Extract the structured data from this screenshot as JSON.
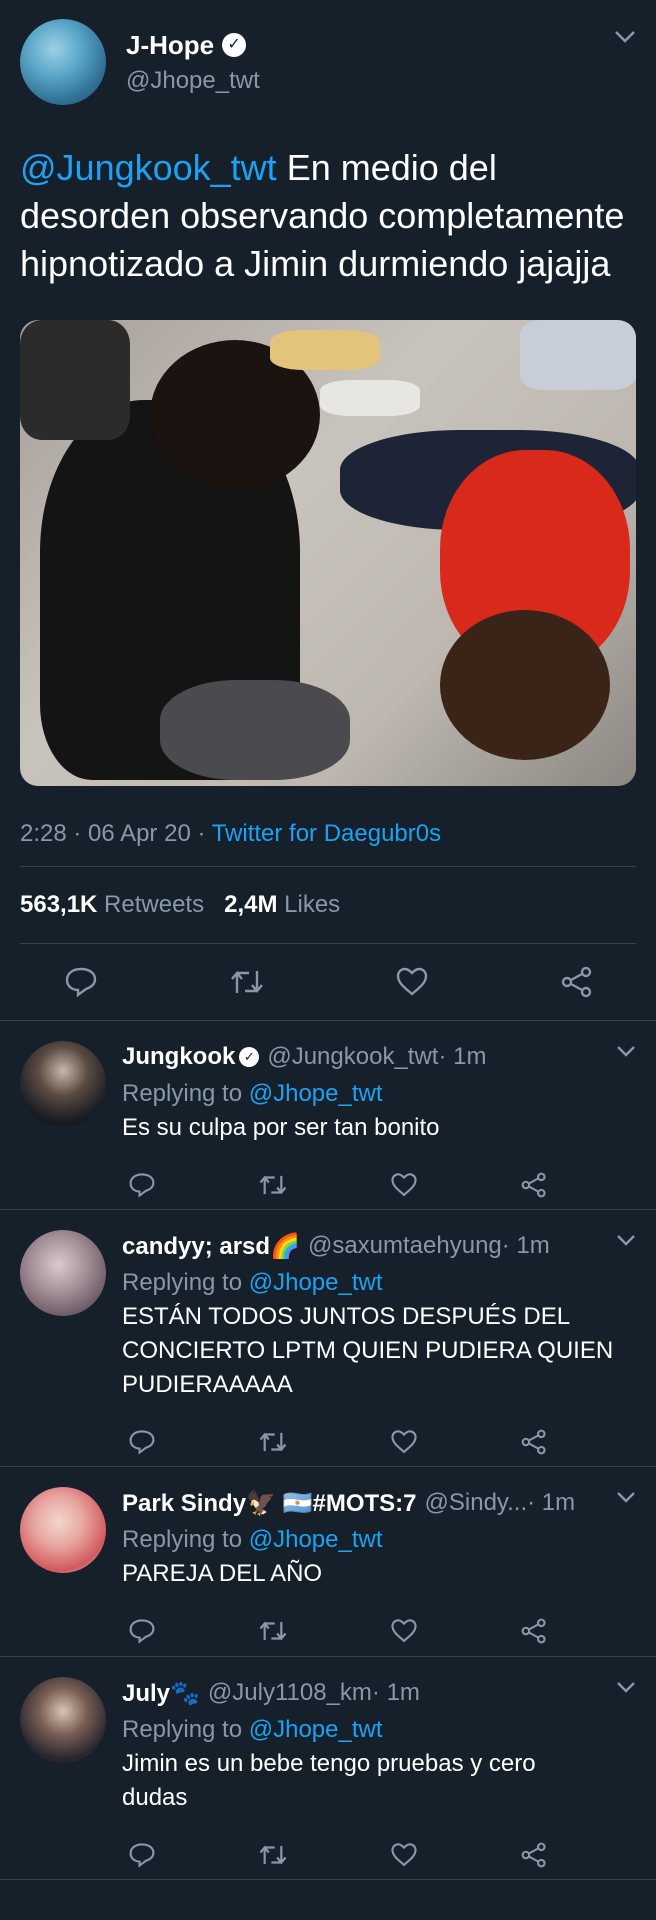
{
  "main_tweet": {
    "display_name": "J-Hope",
    "verified": true,
    "handle": "@Jhope_twt",
    "mention": "@Jungkook_twt",
    "text": " En medio del desorden observando completamente hipnotizado a Jimin durmiendo jajajja",
    "time": "2:28 · 06 Apr 20 · ",
    "source": "Twitter for Daegubr0s",
    "retweets_count": "563,1K",
    "retweets_label": " Retweets",
    "likes_count": "2,4M",
    "likes_label": " Likes"
  },
  "replies": [
    {
      "name": "Jungkook",
      "verified": true,
      "handle": "@Jungkook_twt",
      "time": " · 1m",
      "replying_prefix": "Replying to ",
      "replying_to": "@Jhope_twt",
      "text": [
        "Es su culpa por ser tan bonito"
      ]
    },
    {
      "name": "candyy; arsd🌈",
      "handle": "@saxumtaehyung",
      "time": " · 1m",
      "replying_prefix": "Replying to ",
      "replying_to": "@Jhope_twt",
      "text": [
        "ESTÁN TODOS JUNTOS DESPUÉS DEL",
        "CONCIERTO LPTM QUIEN PUDIERA QUIEN",
        "PUDIERAAAAA"
      ]
    },
    {
      "name": "Park Sindy🦅 🇦🇷#MOTS:7",
      "handle": "@Sindy...",
      "time": " · 1m",
      "replying_prefix": "Replying to ",
      "replying_to": "@Jhope_twt",
      "text": [
        "PAREJA DEL AÑO"
      ]
    },
    {
      "name": "July🐾",
      "handle": "@July1108_km",
      "time": " · 1m",
      "replying_prefix": "Replying to ",
      "replying_to": "@Jhope_twt",
      "text": [
        "Jimin es un bebe tengo pruebas y cero",
        "dudas"
      ]
    }
  ],
  "icons": {
    "reply": "reply-icon",
    "retweet": "retweet-icon",
    "like": "heart-icon",
    "share": "share-icon",
    "menu": "chevron-down-icon",
    "verified": "verified-badge-icon"
  },
  "colors": {
    "background": "#15202b",
    "accent": "#1da1f2",
    "muted": "#8899a6",
    "divider": "#38444d"
  }
}
